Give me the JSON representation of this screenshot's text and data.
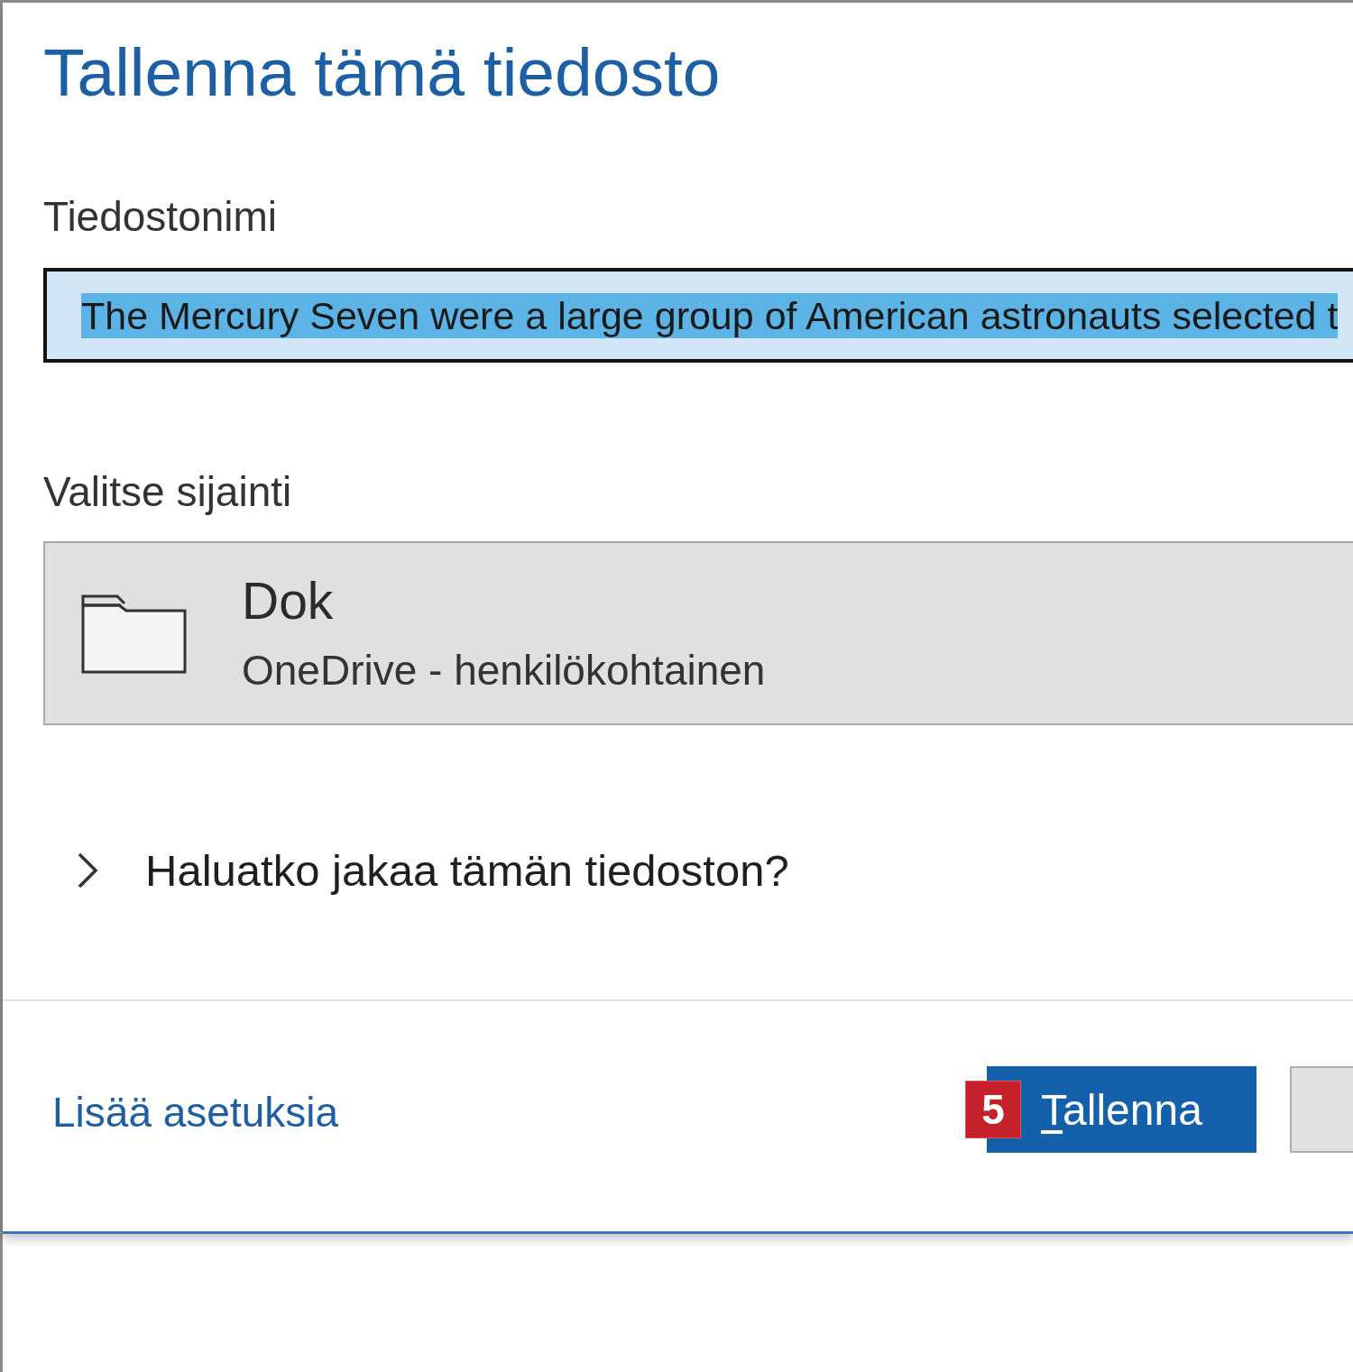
{
  "dialog": {
    "title": "Tallenna tämä tiedosto"
  },
  "filename": {
    "label": "Tiedostonimi",
    "value": "The Mercury Seven were a large group of American astronauts selected t",
    "focused": true,
    "text_selected": true
  },
  "location": {
    "label": "Valitse sijainti",
    "name": "Dok",
    "provider": "OneDrive - henkilökohtainen"
  },
  "share": {
    "label": "Haluatko jakaa tämän tiedoston?",
    "expanded": false
  },
  "footer": {
    "more_options_link": "Lisää asetuksia",
    "buttons": [
      {
        "kind": "primary",
        "label": "Tallenna",
        "access_key_underlined": true,
        "step_badge": "5"
      },
      {
        "kind": "secondary"
      }
    ]
  }
}
